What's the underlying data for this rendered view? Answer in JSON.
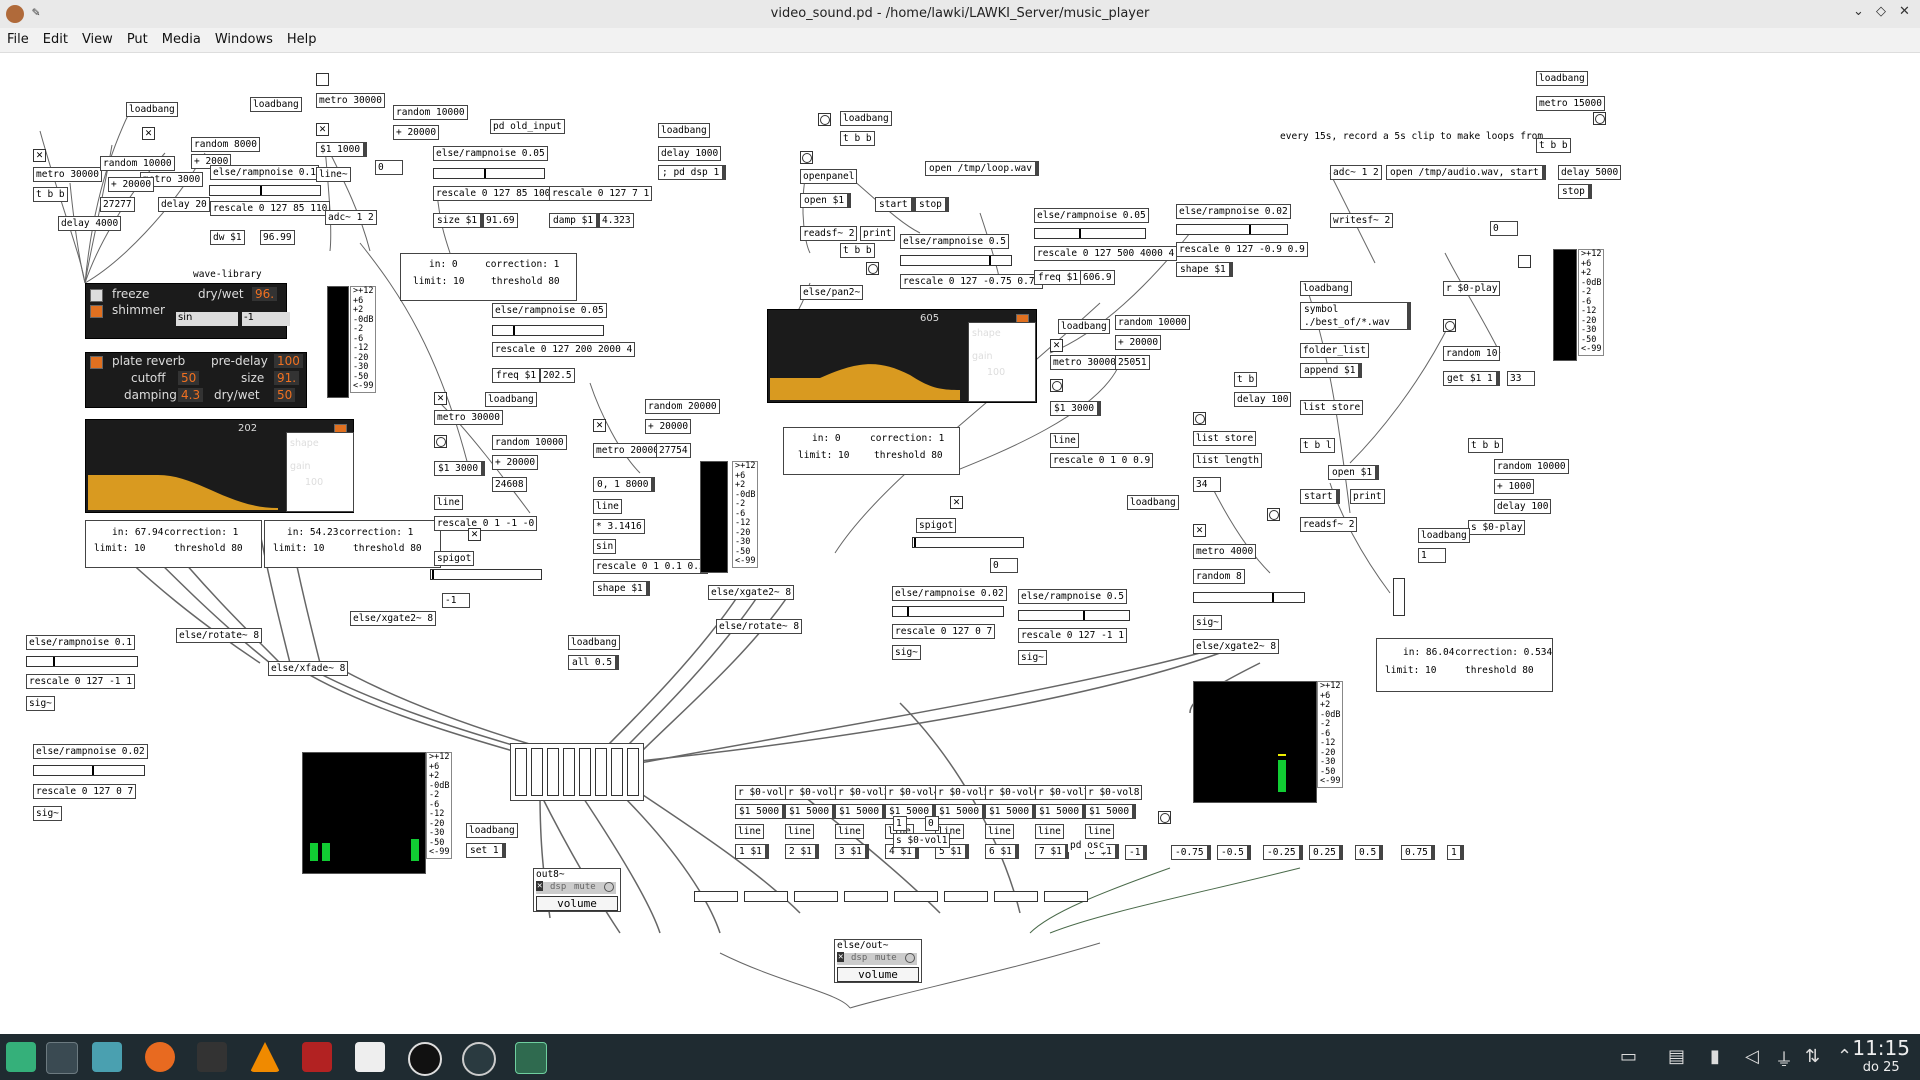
{
  "window": {
    "title": "video_sound.pd - /home/lawki/LAWKI_Server/music_player"
  },
  "menu": [
    "File",
    "Edit",
    "View",
    "Put",
    "Media",
    "Windows",
    "Help"
  ],
  "objects": {
    "loadbang1": "loadbang",
    "loadbang2": "loadbang",
    "metro30000a": "metro 30000",
    "random10000a": "random 10000",
    "tbb1": "t b b",
    "metro3000": "metro 3000",
    "random8000": "random 8000",
    "plus2000": "+ 2000",
    "delay20": "delay 20",
    "delay4000": "delay 4000",
    "n27277": "27277",
    "plus20000a": "+ 20000",
    "rampnoise01": "else/rampnoise 0.1",
    "rescale12785": "rescale 0 127 85 110",
    "dw": "dw $1",
    "n9699": "96.99",
    "metro30000b": "metro 30000",
    "random10000b": "random 10000",
    "plus20000b": "+ 20000",
    "n0a": "0",
    "s1000": "$1 1000",
    "line1": "line~",
    "adc12": "adc~ 1 2",
    "pdold": "pd old_input",
    "loadbang3": "loadbang",
    "delay1000": "delay 1000",
    "pddsp": "; pd dsp 1",
    "ramp005": "else/rampnoise 0.05",
    "rescale85100": "rescale 0 127 85 100",
    "rescale71": "rescale 0 127 7 1",
    "size1": "size $1",
    "n9169": "91.69",
    "damp1": "damp $1",
    "n4323": "4.323",
    "wavelib": "wave-library",
    "comp_in1": "in: 0",
    "comp_corr1": "correction: 1",
    "comp_lim1": "limit: 10",
    "comp_thr1": "threshold 80",
    "ramp005b": "else/rampnoise 0.05",
    "rescale2002000": "rescale 0 127 200 2000 4",
    "freq1": "freq $1",
    "n2025": "202.5",
    "loadbang4": "loadbang",
    "metro30000c": "metro 30000",
    "random10000c": "random 10000",
    "plus20000c": "+ 20000",
    "n24608": "24608",
    "s13000": "$1 3000",
    "line2": "line",
    "rescale01": "rescale 0 1 -1 -0",
    "spigot1": "spigot",
    "n1": "-1",
    "random20000": "random 20000",
    "plus20000d": "+ 20000",
    "metro20000": "metro 20000",
    "n27754": "27754",
    "msg018000": "0, 1 8000",
    "line3": "line",
    "mul3146": "* 3.1416",
    "sin": "sin",
    "rescale0101": "rescale 0 1 0.1 0.5",
    "shape1": "shape $1",
    "loadbang5": "loadbang",
    "tbb2": "t b b",
    "openpanel": "openpanel",
    "open1": "open $1",
    "readsf2": "readsf~ 2",
    "print1": "print",
    "openloop": "open /tmp/loop.wav",
    "start1": "start",
    "stop1": "stop",
    "tbb3": "t b b",
    "pan2": "else/pan2~",
    "ramp05": "else/rampnoise 0.5",
    "rescale075": "rescale 0 127 -0.75 0.75",
    "ramp005c": "else/rampnoise 0.05",
    "rescale5004000": "rescale 0 127 500 4000 4",
    "freq2": "freq $1",
    "n6069": "606.9",
    "ramp002a": "else/rampnoise 0.02",
    "rescale0909": "rescale 0 127 -0.9 0.9",
    "shape2": "shape $1",
    "loadbang6": "loadbang",
    "random10000d": "random 10000",
    "plus20000e": "+ 20000",
    "metro30000d": "metro 30000",
    "n25051": "25051",
    "s13000b": "$1 3000",
    "line4": "line",
    "rescale0109": "rescale 0 1 0 0.9",
    "comp_in2": "in: 0",
    "comp_corr2": "correction: 1",
    "comp_lim2": "limit: 10",
    "comp_thr2": "threshold 80",
    "spigot2": "spigot",
    "n0b": "0",
    "loadbang7": "loadbang",
    "metro15000": "metro 15000",
    "comment15s": "every 15s, record a 5s clip to make loops from",
    "adc12b": "adc~ 1 2",
    "openaudio": "open /tmp/audio.wav, start",
    "tbb4": "t b b",
    "delay5000": "delay 5000",
    "stop2": "stop",
    "writesf": "writesf~ 2",
    "n0c": "0",
    "loadbang8": "loadbang",
    "symbol": "symbol ./best_of/*.wav",
    "folderlist": "folder_list",
    "append": "append $1",
    "tb1": "t b",
    "delay100a": "delay 100",
    "liststore1": "list store",
    "liststore2": "list store",
    "listlength": "list length",
    "n34": "34",
    "tbl": "t b l",
    "open2": "open $1",
    "start2": "start",
    "print2": "print",
    "readsf2b": "readsf~ 2",
    "rs0play": "r $0-play",
    "random10": "random 10",
    "get1": "get $1 1",
    "n33": "33",
    "tbb5": "t b b",
    "random10000e": "random 10000",
    "plus1000": "+ 1000",
    "delay100b": "delay 100",
    "s0play": "s $0-play",
    "loadbang9": "loadbang",
    "n1b": "1",
    "loadbang10": "loadbang",
    "metro4000": "metro 4000",
    "random8": "random 8",
    "sig1": "sig~",
    "xgate8a": "else/xgate2~ 8",
    "comp_in3": "in: 86.04",
    "comp_corr3": "correction: 0.534",
    "comp_lim3": "limit: 10",
    "comp_thr3": "threshold 80",
    "comp_in4": "in: 67.94",
    "comp_corr4": "correction: 1",
    "comp_lim4": "limit: 10",
    "comp_thr4": "threshold 80",
    "comp_in5": "in: 54.23",
    "comp_corr5": "correction: 1",
    "comp_lim5": "limit: 10",
    "comp_thr5": "threshold 80",
    "rotate8a": "else/rotate~ 8",
    "xgate8b": "else/xgate2~ 8",
    "xfade8": "else/xfade~ 8",
    "loadbang11": "loadbang",
    "all05": "all 0.5",
    "ramp01b": "else/rampnoise 0.1",
    "rescale11": "rescale 0 127 -1 1",
    "sig2": "sig~",
    "ramp002b": "else/rampnoise 0.02",
    "rescale07a": "rescale 0 127 0 7",
    "sig3": "sig~",
    "xgate8c": "else/xgate2~ 8",
    "rotate8b": "else/rotate~ 8",
    "ramp002c": "else/rampnoise 0.02",
    "rescale07b": "rescale 0 127 0 7",
    "sig4": "sig~",
    "ramp05b": "else/rampnoise 0.5",
    "rescale11b": "rescale 0 127 -1 1",
    "sig5": "sig~",
    "loadbang12": "loadbang",
    "set1": "set 1",
    "out8": "out8~",
    "pdosc": "pd osc",
    "svol": "s $0-vol1",
    "elseout": "else/out~",
    "vols": [
      "r $0-vol1",
      "r $0-vol2",
      "r $0-vol3",
      "r $0-vol4",
      "r $0-vol5",
      "r $0-vol6",
      "r $0-vol7",
      "r $0-vol8"
    ],
    "vol5000": [
      "$1 5000",
      "$1 5000",
      "$1 5000",
      "$1 5000",
      "$1 5000",
      "$1 5000",
      "$1 5000",
      "$1 5000"
    ],
    "volline": [
      "line",
      "line",
      "line",
      "line",
      "line",
      "line",
      "line",
      "line"
    ],
    "volout": [
      "1 $1",
      "2 $1",
      "3 $1",
      "4 $1",
      "5 $1",
      "6 $1",
      "7 $1",
      "8 $1"
    ],
    "panmsgs": [
      "-1",
      "-0.75",
      "-0.5",
      "-0.25",
      "0.25",
      "0.5",
      "0.75",
      "1"
    ],
    "n1c": "1",
    "n0d": "0"
  },
  "panels": {
    "freeze": {
      "freeze": "freeze",
      "drywet": "dry/wet",
      "drywet_val": "96.",
      "shimmer": "shimmer",
      "wave": "sin",
      "num": "-1"
    },
    "plate": {
      "title": "plate reverb",
      "predelay": "pre-delay",
      "predelay_val": "100",
      "cutoff": "cutoff",
      "cutoff_val": "50",
      "size": "size",
      "size_val": "91.",
      "damping": "damping",
      "damping_val": "4.3",
      "drywet": "dry/wet",
      "drywet_val": "50"
    },
    "env1": {
      "value": "202",
      "shape": "shape",
      "gain": "gain",
      "gain_val": "100"
    },
    "env2": {
      "value": "605",
      "shape": "shape",
      "gain": "gain",
      "gain_val": "100"
    }
  },
  "vu_scale": [
    ">+12",
    "+6",
    "+2",
    "-0dB",
    "-2",
    "-6",
    "-12",
    "-20",
    "-30",
    "-50",
    "<-99"
  ],
  "channels": [
    "1",
    "2",
    "3",
    "4",
    "5",
    "6",
    "7",
    "8"
  ],
  "out_ctrl": {
    "dsp": "dsp",
    "mute": "mute",
    "volume": "volume"
  },
  "taskbar": {
    "time": "11:15",
    "date": "do 25"
  },
  "colors": {
    "accent": "#e07020",
    "panel": "#1b1b1b",
    "envfill": "#d99a20",
    "taskbar": "#1f2b31"
  }
}
